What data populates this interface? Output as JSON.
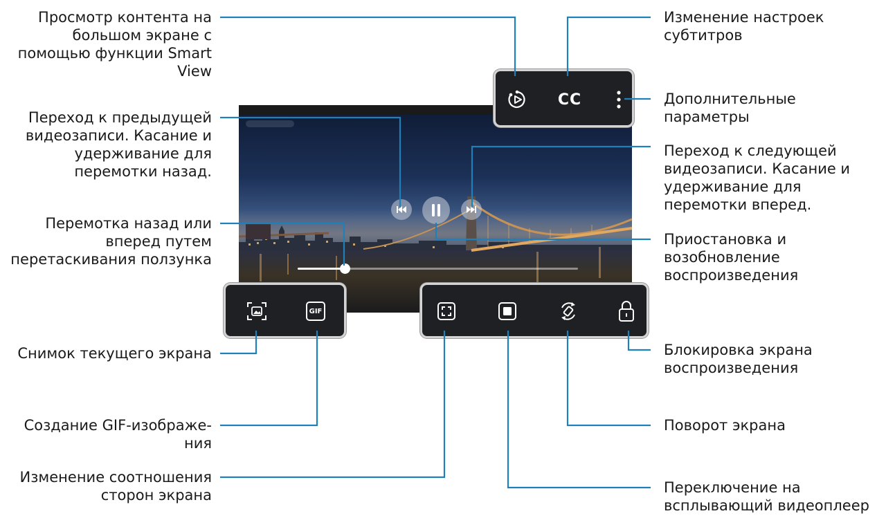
{
  "colors": {
    "leader": "#1f7fb8",
    "panel_bg": "#1f2023",
    "panel_border": "#d4d4d4"
  },
  "panels": {
    "top": {
      "icons": [
        "smart-view-icon",
        "cc-icon",
        "more-options-icon"
      ],
      "cc_label": "CC"
    },
    "bottom_left": {
      "icons": [
        "screenshot-icon",
        "gif-icon"
      ],
      "gif_label": "GIF"
    },
    "bottom_right": {
      "icons": [
        "aspect-ratio-icon",
        "popup-player-icon",
        "rotate-screen-icon",
        "lock-icon"
      ]
    }
  },
  "player": {
    "controls": [
      "previous-icon",
      "pause-icon",
      "next-icon"
    ],
    "seek_progress": 0.17
  },
  "callouts": {
    "smart_view": [
      "Просмотр контента на",
      "большом экране с",
      "помощью функции Smart",
      "View"
    ],
    "previous": [
      "Переход к предыдущей",
      "видеозаписи. Касание и",
      "удерживание для",
      "перемотки назад."
    ],
    "seek": [
      "Перемотка назад или",
      "вперед путем",
      "перетаскивания ползунка"
    ],
    "screenshot": [
      "Снимок текущего экрана"
    ],
    "gif": [
      "Создание GIF-изображе-",
      "ния"
    ],
    "aspect": [
      "Изменение соотношения",
      "сторон экрана"
    ],
    "subtitles": [
      "Изменение настроек",
      "субтитров"
    ],
    "more": [
      "Дополнительные",
      "параметры"
    ],
    "next": [
      "Переход к следующей",
      "видеозаписи. Касание и",
      "удерживание для",
      "перемотки вперед."
    ],
    "pause": [
      "Приостановка и",
      "возобновление",
      "воспроизведения"
    ],
    "lock": [
      "Блокировка экрана",
      "воспроизведения"
    ],
    "rotate": [
      "Поворот экрана"
    ],
    "popup": [
      "Переключение на",
      "всплывающий видеоплеер"
    ]
  }
}
